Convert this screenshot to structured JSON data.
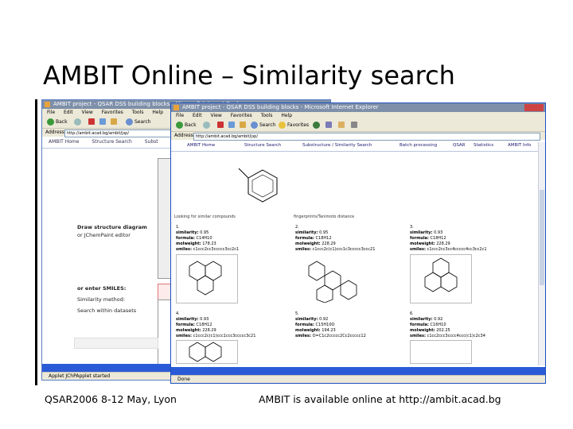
{
  "slide": {
    "title": "AMBIT Online – Similarity search",
    "footer_left": "QSAR2006 8-12 May, Lyon",
    "footer_right": "AMBIT is available online at http://ambit.acad.bg"
  },
  "back_window": {
    "title": "AMBIT project - QSAR DSS building blocks - Microsoft Internet Explorer",
    "menu": [
      "File",
      "Edit",
      "View",
      "Favorites",
      "Tools",
      "Help"
    ],
    "toolbar": {
      "back": "Back",
      "search": "Search"
    },
    "address_label": "Address",
    "address": "http://ambit.acad.bg/ambit/jsp/",
    "nav": [
      "AMBIT Home",
      "Structure Search",
      "Subst"
    ],
    "draw_label": "Draw structure diagram",
    "draw_sub": "or  JChemPaint  editor",
    "smiles_label": "or enter SMILES:",
    "method_label": "Similarity method:",
    "datasets_label": "Search within datasets",
    "status": "Applet JChPApplet started"
  },
  "front_window": {
    "title": "AMBIT project - QSAR DSS building blocks - Microsoft Internet Explorer",
    "menu": [
      "File",
      "Edit",
      "View",
      "Favorites",
      "Tools",
      "Help"
    ],
    "toolbar": {
      "back": "Back",
      "search": "Search",
      "favorites": "Favorites"
    },
    "address_label": "Address",
    "address": "http://ambit.acad.bg/ambit/jsp/",
    "nav": [
      "AMBIT Home",
      "Structure Search",
      "Substructure / Similarity Search",
      "Batch processing",
      "QSAR",
      "Statistics",
      "AMBIT Info"
    ],
    "results_header": "Looking for similar compounds",
    "results_header_right": "fingerprints/Tanimoto distance",
    "results": [
      {
        "num": "1.",
        "similarity": "0.95",
        "formula": "C14H10",
        "mw": "178.23",
        "smiles": "c1ccc2cc3ccccc3cc2c1"
      },
      {
        "num": "2.",
        "similarity": "0.95",
        "formula": "C18H12",
        "mw": "228.29",
        "smiles": "c1ccc2c(c1)ccc1c3ccccc3ccc21"
      },
      {
        "num": "3.",
        "similarity": "0.93",
        "formula": "C18H12",
        "mw": "228.29",
        "smiles": "c1ccc2cc3cc4ccccc4cc3cc2c1"
      },
      {
        "num": "4.",
        "similarity": "0.93",
        "formula": "C18H12",
        "mw": "228.29",
        "smiles": "c1ccc2c(c1)ccc1ccc3ccccc3c21"
      },
      {
        "num": "5.",
        "similarity": "0.92",
        "formula": "C15H10O",
        "mw": "194.23",
        "smiles": "O=C1c2ccccc2Cc2ccccc12"
      },
      {
        "num": "6.",
        "similarity": "0.92",
        "formula": "C16H10",
        "mw": "202.25",
        "smiles": "c1cc2ccc3cccc4ccc(c1)c2c34"
      }
    ],
    "field_labels": {
      "similarity": "similarity:",
      "formula": "formula:",
      "mw": "molweight:",
      "smiles": "smiles:"
    },
    "status": "Done"
  },
  "colors": {
    "titlebar": "#7e8fa9",
    "taskbar": "#2a5bd7",
    "chrome": "#ece9d8",
    "link": "#1a1a6e",
    "window_border": "#1c4fbf"
  }
}
